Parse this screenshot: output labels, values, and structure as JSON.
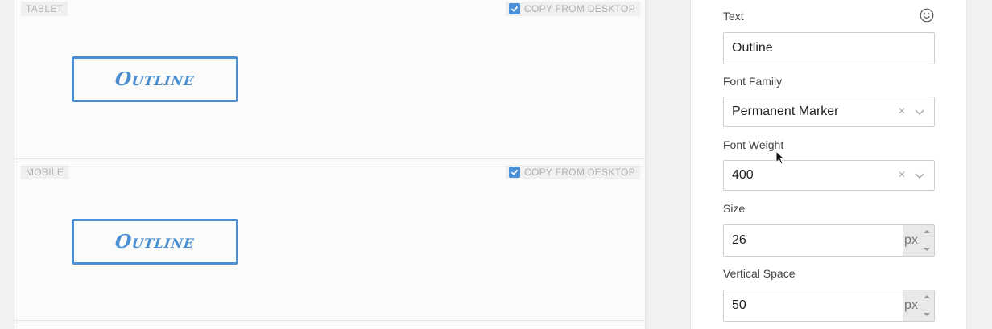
{
  "preview": {
    "sections": [
      {
        "label": "TABLET",
        "copy_label": "COPY FROM DESKTOP",
        "copy_checked": true,
        "button_text": "Outline"
      },
      {
        "label": "MOBILE",
        "copy_label": "COPY FROM DESKTOP",
        "copy_checked": true,
        "button_text": "Outline"
      }
    ]
  },
  "settings": {
    "text": {
      "label": "Text",
      "value": "Outline",
      "icon": "smiley-icon"
    },
    "font_family": {
      "label": "Font Family",
      "value": "Permanent Marker"
    },
    "font_weight": {
      "label": "Font Weight",
      "value": "400"
    },
    "size": {
      "label": "Size",
      "value": "26",
      "unit": "px"
    },
    "vertical_space": {
      "label": "Vertical Space",
      "value": "50",
      "unit": "px"
    }
  },
  "colors": {
    "accent": "#4a8fd2",
    "checkbox": "#4a90d9"
  }
}
